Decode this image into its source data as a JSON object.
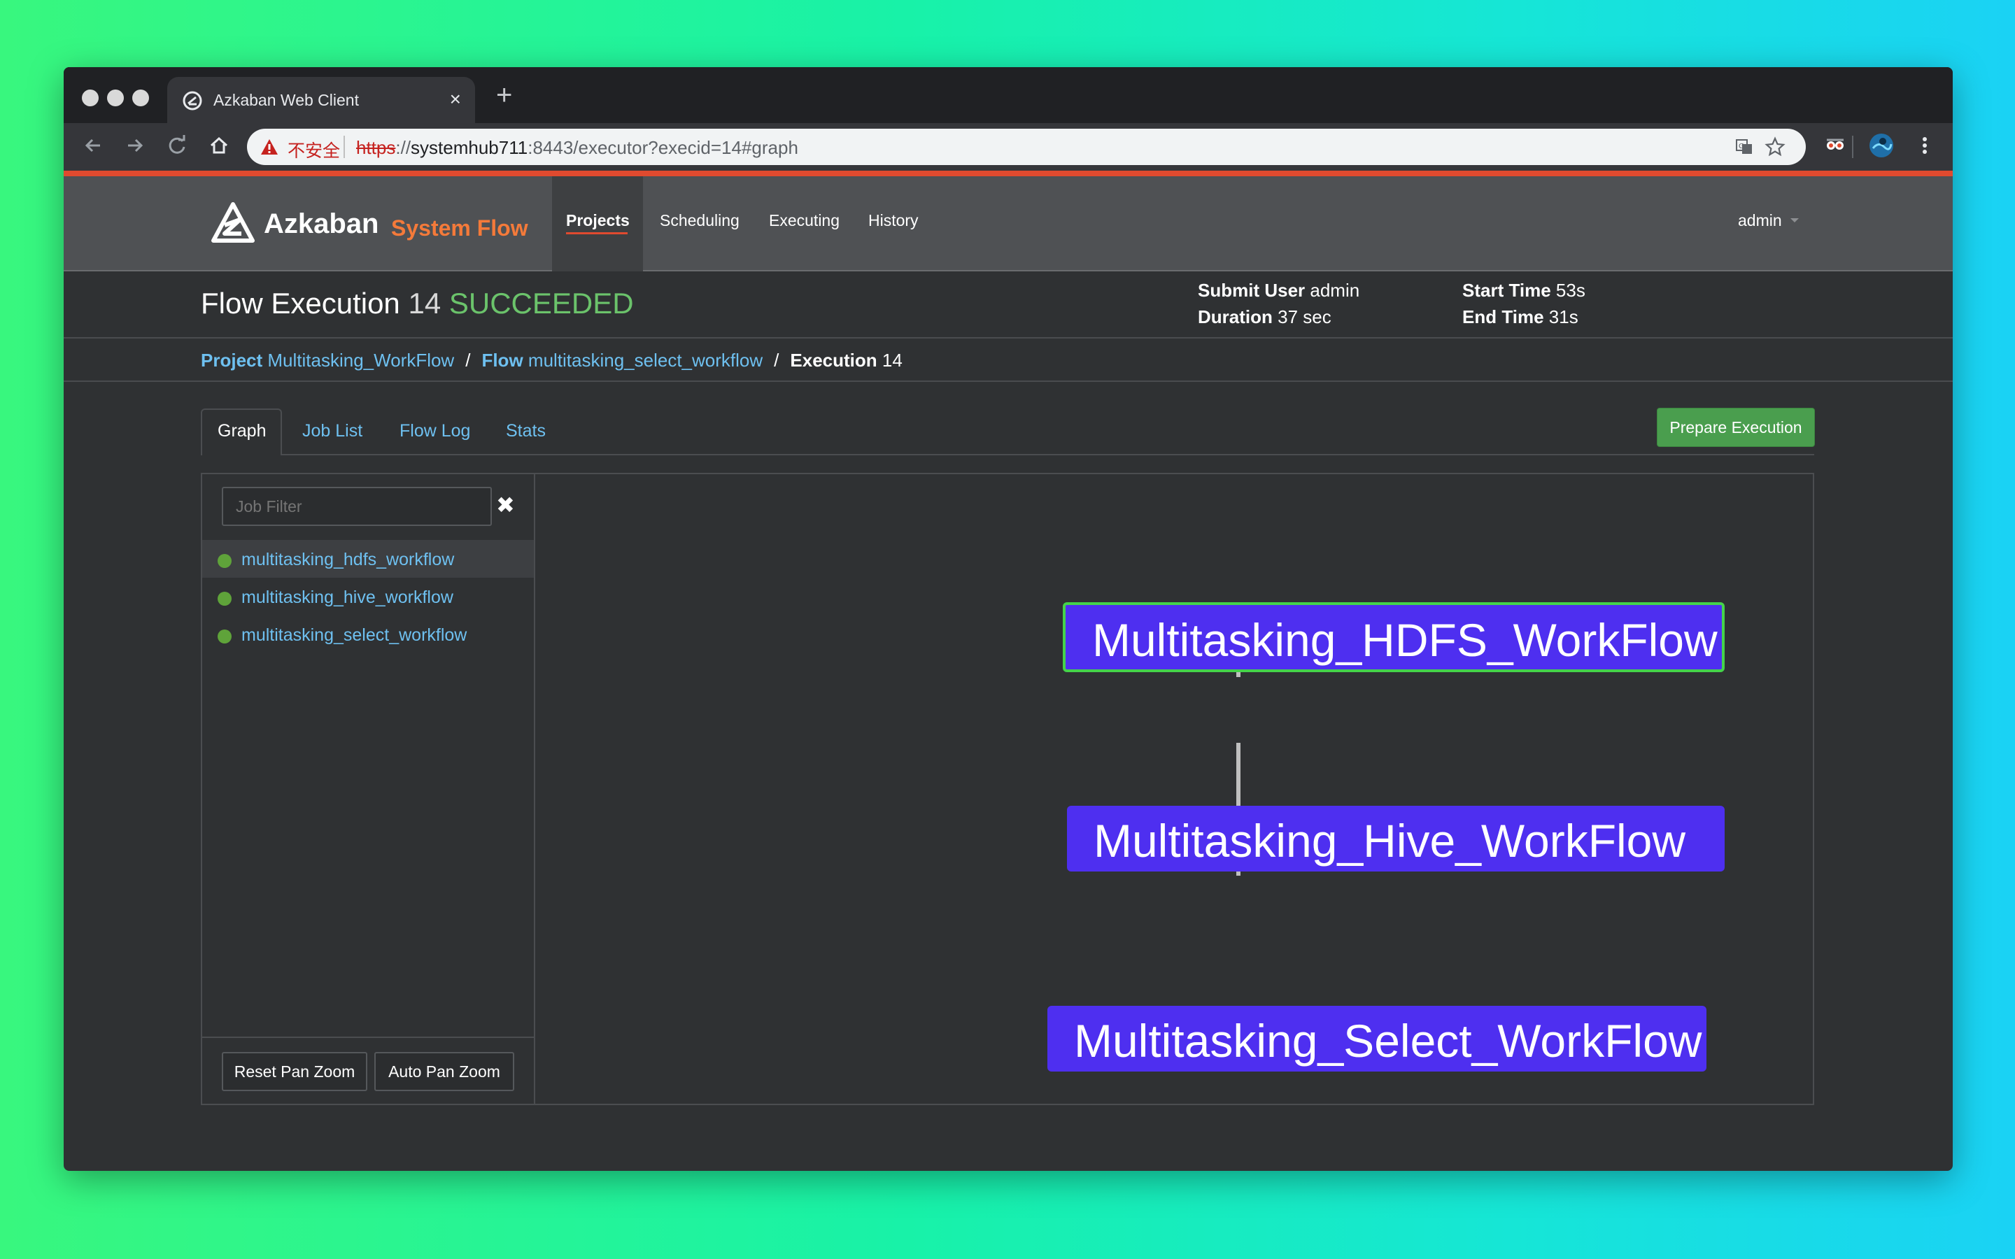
{
  "browser": {
    "tab_title": "Azkaban Web Client",
    "tab_close": "×",
    "new_tab": "+",
    "insecure_label": "不安全",
    "url_scheme": "https",
    "url_sep": "://",
    "url_host": "systemhub711",
    "url_rest": ":8443/executor?execid=14#graph"
  },
  "header": {
    "brand": "Azkaban",
    "subtitle": "System Flow",
    "nav": [
      "Projects",
      "Scheduling",
      "Executing",
      "History"
    ],
    "active_nav": "Projects",
    "user": "admin"
  },
  "execution": {
    "title": "Flow Execution",
    "id": "14",
    "status": "SUCCEEDED",
    "submit_user_label": "Submit User",
    "submit_user": "admin",
    "duration_label": "Duration",
    "duration": "37 sec",
    "start_time_label": "Start Time",
    "start_time": "53s",
    "end_time_label": "End Time",
    "end_time": "31s"
  },
  "breadcrumb": {
    "project_label": "Project",
    "project": "Multitasking_WorkFlow",
    "flow_label": "Flow",
    "flow": "multitasking_select_workflow",
    "execution_label": "Execution",
    "execution": "14",
    "separator": "/"
  },
  "tabs": [
    "Graph",
    "Job List",
    "Flow Log",
    "Stats"
  ],
  "active_tab": "Graph",
  "prepare_button": "Prepare Execution",
  "sidebar": {
    "filter_placeholder": "Job Filter",
    "clear_icon": "✖",
    "jobs": [
      {
        "name": "multitasking_hdfs_workflow",
        "status": "success"
      },
      {
        "name": "multitasking_hive_workflow",
        "status": "success"
      },
      {
        "name": "multitasking_select_workflow",
        "status": "success"
      }
    ],
    "reset_button": "Reset Pan Zoom",
    "auto_button": "Auto Pan Zoom"
  },
  "graph": {
    "nodes": [
      "Multitasking_HDFS_WorkFlow",
      "Multitasking_Hive_WorkFlow",
      "Multitasking_Select_WorkFlow"
    ],
    "selected_node": "Multitasking_HDFS_WorkFlow"
  },
  "colors": {
    "node_fill": "#4e2ff0",
    "node_selected_border": "#44d34a",
    "status_success": "#6bc36b",
    "accent": "#e04a2f",
    "link": "#6ec0f0"
  }
}
